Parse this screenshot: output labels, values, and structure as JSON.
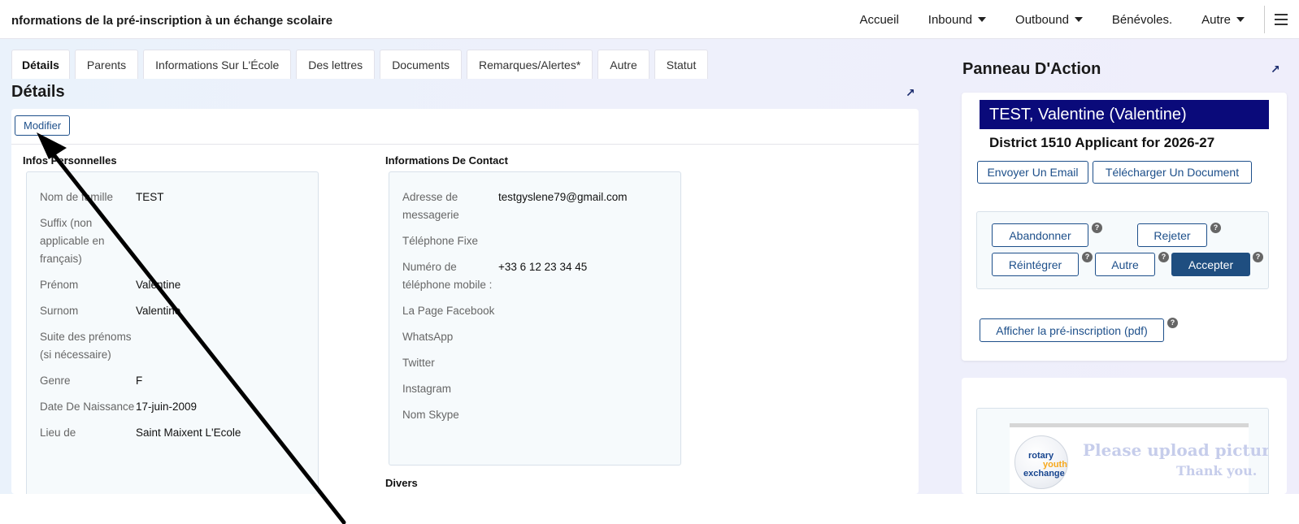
{
  "header": {
    "title": "nformations de la pré-inscription à un échange scolaire",
    "nav": [
      {
        "label": "Accueil",
        "dropdown": false
      },
      {
        "label": "Inbound",
        "dropdown": true
      },
      {
        "label": "Outbound",
        "dropdown": true
      },
      {
        "label": "Bénévoles.",
        "dropdown": false
      },
      {
        "label": "Autre",
        "dropdown": true
      }
    ]
  },
  "tabs": [
    "Détails",
    "Parents",
    "Informations Sur L'École",
    "Des lettres",
    "Documents",
    "Remarques/Alertes*",
    "Autre",
    "Statut"
  ],
  "details": {
    "title": "Détails",
    "modify_label": "Modifier",
    "personal": {
      "heading": "Infos Personnelles",
      "rows": [
        {
          "label": "Nom de famille",
          "value": "TEST"
        },
        {
          "label": "Suffix (non applicable en français)",
          "value": ""
        },
        {
          "label": "Prénom",
          "value": "Valentine"
        },
        {
          "label": "Surnom",
          "value": "Valentine"
        },
        {
          "label": "Suite des prénoms (si nécessaire)",
          "value": ""
        },
        {
          "label": "Genre",
          "value": "F"
        },
        {
          "label": "Date De Naissance",
          "value": "17-juin-2009"
        },
        {
          "label": "Lieu de",
          "value": "Saint Maixent L'Ecole"
        }
      ]
    },
    "contact": {
      "heading": "Informations De Contact",
      "rows": [
        {
          "label": "Adresse de messagerie",
          "value": "testgyslene79@gmail.com"
        },
        {
          "label": "Téléphone Fixe",
          "value": ""
        },
        {
          "label": "Numéro de téléphone mobile :",
          "value": "+33 6 12 23 34 45"
        },
        {
          "label": "La Page Facebook",
          "value": ""
        },
        {
          "label": "WhatsApp",
          "value": ""
        },
        {
          "label": "Twitter",
          "value": ""
        },
        {
          "label": "Instagram",
          "value": ""
        },
        {
          "label": "Nom Skype",
          "value": ""
        }
      ]
    },
    "misc_heading": "Divers"
  },
  "action_panel": {
    "title": "Panneau D'Action",
    "name": "TEST, Valentine (Valentine)",
    "applicant": "District 1510 Applicant for 2026-27",
    "email_label": "Envoyer Un Email",
    "upload_label": "Télécharger Un Document",
    "abandon_label": "Abandonner",
    "reject_label": "Rejeter",
    "reinstate_label": "Réintégrer",
    "other_label": "Autre",
    "accept_label": "Accepter",
    "pdf_label": "Afficher la pré-inscription (pdf)",
    "help_glyph": "?"
  },
  "photo": {
    "logo_line1": "rotary",
    "logo_line2": "youth",
    "logo_line3": "exchange",
    "upload_text": "Please upload picture.",
    "thanks_text": "Thank you."
  },
  "icons": {
    "expand": "↗"
  },
  "colors": {
    "accent": "#1d4f8a",
    "banner": "#0a0a7a",
    "primary_button": "#1f4e80"
  }
}
